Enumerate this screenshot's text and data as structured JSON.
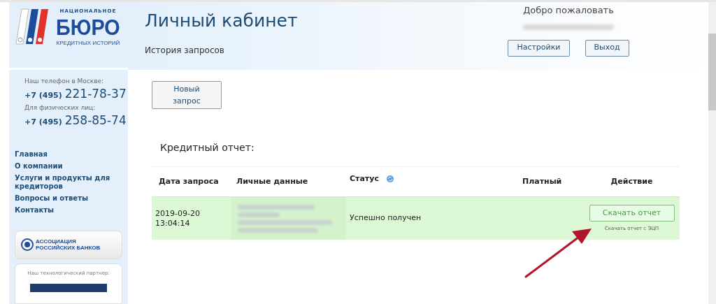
{
  "logo": {
    "top": "НАЦИОНАЛЬНОЕ",
    "main": "БЮРО",
    "bottom": "КРЕДИТНЫХ ИСТОРИЙ"
  },
  "header": {
    "title": "Личный кабинет",
    "subtitle": "История запросов"
  },
  "user": {
    "greeting": "Добро пожаловать",
    "buttons": [
      "Настройки",
      "Выход"
    ]
  },
  "phones": [
    {
      "label": "Наш телефон в Москве:",
      "code": "+7 (495)",
      "number": "221-78-37"
    },
    {
      "label": "Для физических лиц:",
      "code": "+7 (495)",
      "number": "258-85-74"
    }
  ],
  "nav": [
    "Главная",
    "О компании",
    "Услуги и продукты для кредиторов",
    "Вопросы и ответы",
    "Контакты"
  ],
  "banner": {
    "text": "АССОЦИАЦИЯ РОССИЙСКИХ БАНКОВ"
  },
  "partner": {
    "label": "Наш технологический партнер:"
  },
  "new_request_button": "Новый запрос",
  "section_title": "Кредитный отчет:",
  "table": {
    "columns": [
      "Дата запроса",
      "Личные данные",
      "Статус",
      "Платный",
      "Действие"
    ],
    "rows": [
      {
        "date": "2019-09-20 13:04:14",
        "status": "Успешно получен",
        "action": "Скачать отчет",
        "action_sub": "Скачать отчет с ЭЦП"
      }
    ]
  }
}
